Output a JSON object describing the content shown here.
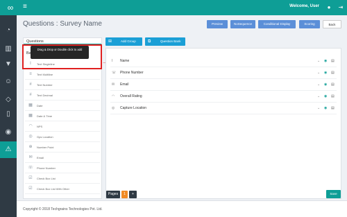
{
  "app": {
    "welcome": "Welcome, User"
  },
  "page": {
    "title": "Questions : Survey Name"
  },
  "header_buttons": {
    "preview": "Preview",
    "nosequence": "NoSequence",
    "conditional": "Conditional Display",
    "scoring": "Scoring",
    "back": "Back"
  },
  "toolbar": {
    "add_group": "Add Group",
    "question_bank": "Question Bank"
  },
  "left": {
    "heading": "Questions",
    "basic": "Basic",
    "tooltip": "Drag & Drop or Double click to add",
    "items": [
      {
        "label": "Text Singleline",
        "icon": "I"
      },
      {
        "label": "Text Multiline",
        "icon": "≡"
      },
      {
        "label": "Text Number",
        "icon": "#"
      },
      {
        "label": "Text Decimal",
        "icon": "#"
      },
      {
        "label": "Date",
        "icon": "▦"
      },
      {
        "label": "Date & Time",
        "icon": "▦"
      },
      {
        "label": "NPS",
        "icon": "◠"
      },
      {
        "label": "Gps Location",
        "icon": "◎"
      },
      {
        "label": "Number Point",
        "icon": "⊕"
      },
      {
        "label": "Email",
        "icon": "✉"
      },
      {
        "label": "Phone Number",
        "icon": "☏"
      },
      {
        "label": "Check Box List",
        "icon": "☑"
      },
      {
        "label": "Check Box List With Other",
        "icon": "☑"
      }
    ]
  },
  "questions": [
    {
      "label": "Name",
      "icon": "I"
    },
    {
      "label": "Phone Number",
      "icon": "☏"
    },
    {
      "label": "Email",
      "icon": "✉"
    },
    {
      "label": "Overall Rating",
      "icon": "◠"
    },
    {
      "label": "Capture Location",
      "icon": "◎"
    }
  ],
  "pager": {
    "label": "Pages",
    "current": "1",
    "add": "+"
  },
  "save": "Save",
  "footer": "Copyright © 2018 Techgrains Technologies Pvt. Ltd."
}
